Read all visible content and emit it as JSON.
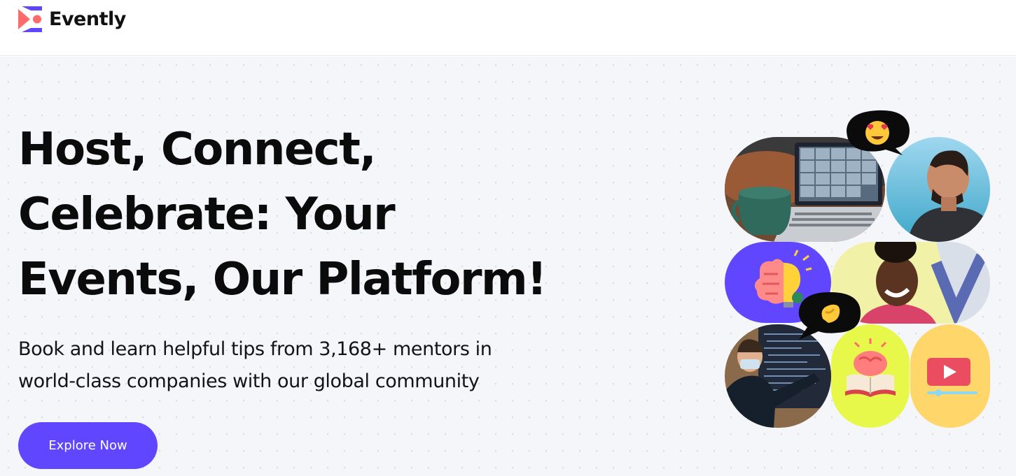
{
  "brand": {
    "name": "Evently",
    "accent": "#6047ff"
  },
  "hero": {
    "title_lines": [
      "Host, Connect,",
      "Celebrate: Your",
      "Events, Our Platform!"
    ],
    "subtitle_lines": [
      "Book and learn helpful tips from 3,168+ mentors in",
      "world-class companies with our global community"
    ],
    "cta_label": "Explore Now"
  },
  "collage": {
    "tiles": [
      {
        "id": "laptop-video-call-photo",
        "color": "#8a5a3a"
      },
      {
        "id": "smiling-man-photo",
        "color": "#5cb6dc"
      },
      {
        "id": "brain-lightbulb-illustration",
        "color": "#6047ff"
      },
      {
        "id": "laughing-woman-photo",
        "color": "#f1f2a8"
      },
      {
        "id": "presenter-at-screen-photo",
        "color": "#2a3346"
      },
      {
        "id": "brain-book-illustration",
        "color": "#e7f84b"
      },
      {
        "id": "video-player-illustration",
        "color": "#ffd66a"
      }
    ],
    "bubbles": [
      {
        "id": "heart-eyes-emoji",
        "color": "#0b0b0b"
      },
      {
        "id": "pinching-hand-emoji",
        "color": "#0b0b0b"
      }
    ]
  }
}
